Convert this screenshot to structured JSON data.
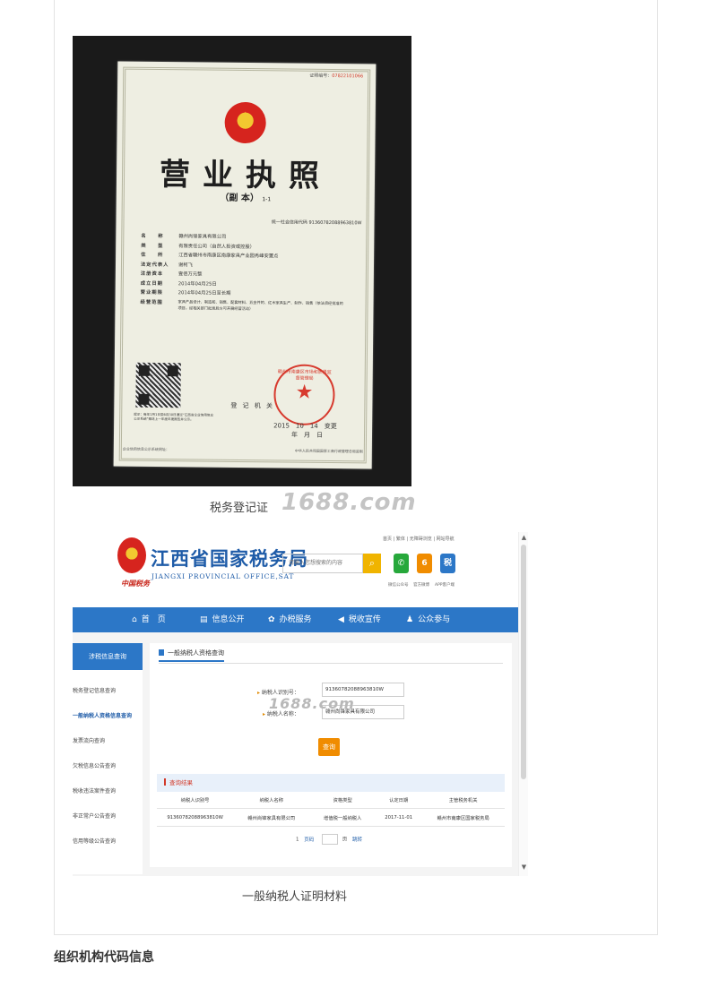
{
  "license": {
    "cert_no_label": "证照编号：",
    "cert_no": "07822101066",
    "title": "营业执照",
    "subtitle": "（副 本）",
    "copy_no": "1-1",
    "credit_code": "统一社会信用代码 91360782088963810W",
    "fields": [
      {
        "k": "名　　称",
        "v": "赣州尚锋家具有限公司"
      },
      {
        "k": "类　　型",
        "v": "有限责任公司（自然人投资或控股）"
      },
      {
        "k": "住　　所",
        "v": "江西省赣州市南康区南康家具产业园秀峰安置点"
      },
      {
        "k": "法定代表人",
        "v": "谢柯飞"
      },
      {
        "k": "注册资本",
        "v": "壹佰万元整"
      },
      {
        "k": "成立日期",
        "v": "2014年04月25日"
      },
      {
        "k": "营业期限",
        "v": "2014年04月25日至长期"
      },
      {
        "k": "经营范围",
        "v": "家具产品设计、制造和、销售、配套材料、五金件的、红木家具生产、制作、销售（依法须经批准的项目，经相关部门批准后方可开展经营活动）"
      }
    ],
    "qr_note": "提示：每年1月1日至6月30日通过“江西省企业信用信息公示系统”报送上一年度年度报告并公示。",
    "seal_text": "赣州市南康区市场和质量监督管理局",
    "reg_office": "登 记 机 关",
    "reg_date": "2015　10　14　变更",
    "reg_date_units": "年　月　日",
    "footer_left": "企业信用信息公示系统网址：",
    "footer_right": "中华人民共和国国家工商行政管理总局监制"
  },
  "caption_license": "税务登记证",
  "watermark": "1688.com",
  "tax_site": {
    "name_cn": "江西省国家税务局",
    "name_en": "JIANGXI PROVINCIAL OFFICE,SAT",
    "slogan": "中国税务",
    "search_placeholder": "请输入您想搜索的内容",
    "search_icon": "search-icon",
    "top_links": "首页 | 繁体 | 无障碍浏览 | 网站导航",
    "icons": [
      {
        "glyph": "✆",
        "color": "#27a83b",
        "label": "微信公众号"
      },
      {
        "glyph": "6",
        "color": "#f08c00",
        "label": "官方微博"
      },
      {
        "glyph": "税",
        "color": "#2c77c7",
        "label": "APP客户端"
      }
    ],
    "nav": [
      {
        "icon": "home-icon",
        "glyph": "⌂",
        "label": "首　页"
      },
      {
        "icon": "document-icon",
        "glyph": "▤",
        "label": "信息公开"
      },
      {
        "icon": "service-icon",
        "glyph": "✿",
        "label": "办税服务"
      },
      {
        "icon": "megaphone-icon",
        "glyph": "◀",
        "label": "税收宣传"
      },
      {
        "icon": "people-icon",
        "glyph": "♟",
        "label": "公众参与"
      }
    ],
    "sidebar_head": "涉税信息查询",
    "sidebar_items": [
      {
        "label": "税务登记信息查询",
        "active": false
      },
      {
        "label": "一般纳税人资格信息查询",
        "active": true
      },
      {
        "label": "发票流向查询",
        "active": false
      },
      {
        "label": "欠税信息公告查询",
        "active": false
      },
      {
        "label": "税收违法案件查询",
        "active": false
      },
      {
        "label": "非正常户公告查询",
        "active": false
      },
      {
        "label": "信用等级公告查询",
        "active": false
      }
    ],
    "panel_title": "一般纳税人资格查询",
    "field_id_label": "纳税人识别号：",
    "field_id_value": "91360782088963810W",
    "field_name_label": "纳税人名称：",
    "field_name_value": "赣州尚锋家具有限公司",
    "query_button": "查询",
    "result_title": "查询结果",
    "columns": [
      "纳税人识别号",
      "纳税人名称",
      "资格类型",
      "认定日期",
      "主管税务机关"
    ],
    "rows": [
      [
        "91360782088963810W",
        "赣州尚锋家具有限公司",
        "增值税一般纳税人",
        "2017-11-01",
        "赣州市南康区国家税务局"
      ]
    ],
    "pager_current": "1",
    "pager_go_prefix": "页码",
    "pager_go_suffix": "页",
    "pager_go": "跳转"
  },
  "caption_tax": "一般纳税人证明材料",
  "section_heading": "组织机构代码信息"
}
